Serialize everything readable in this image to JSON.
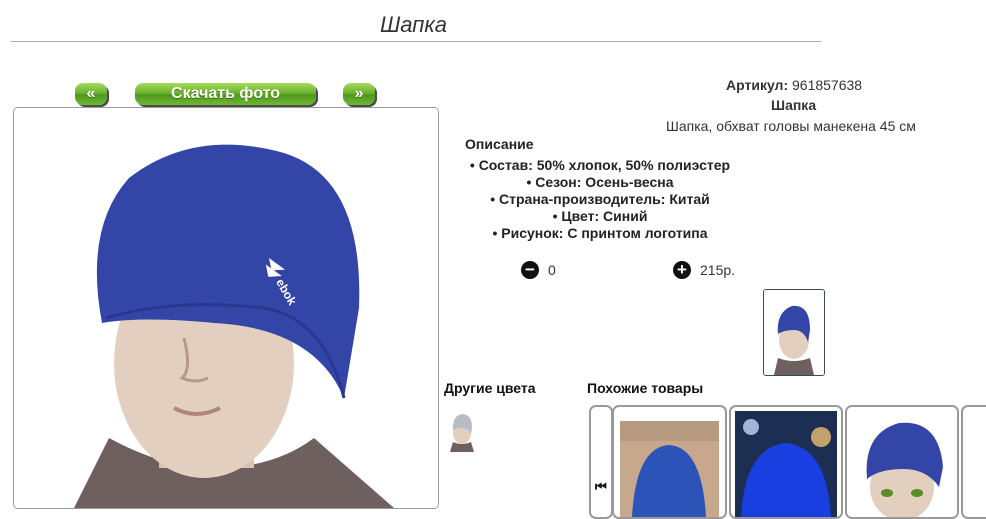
{
  "product": {
    "title": "Шапка",
    "article_label": "Артикул:",
    "article_value": "961857638",
    "name": "Шапка",
    "subtitle": "Шапка, обхват головы манекена 45 см"
  },
  "gallery": {
    "prev_label": "«",
    "download_label": "Скачать фото",
    "next_label": "»"
  },
  "description": {
    "heading": "Описание",
    "items": [
      "Состав: 50% хлопок, 50% полиэстер",
      "Сезон: Осень-весна",
      "Страна-производитель: Китай",
      "Цвет: Синий",
      "Рисунок: С принтом логотипа"
    ]
  },
  "cart": {
    "minus_label": "−",
    "quantity": "0",
    "plus_label": "+",
    "price": "215р."
  },
  "sections": {
    "other_colors": "Другие цвета",
    "similar": "Похожие товары",
    "scroll_left": "⏮"
  },
  "colors": {
    "accent_green": "#6cb12f",
    "hat_blue": "#3445a8",
    "hat_gray": "#b8bcc4"
  }
}
